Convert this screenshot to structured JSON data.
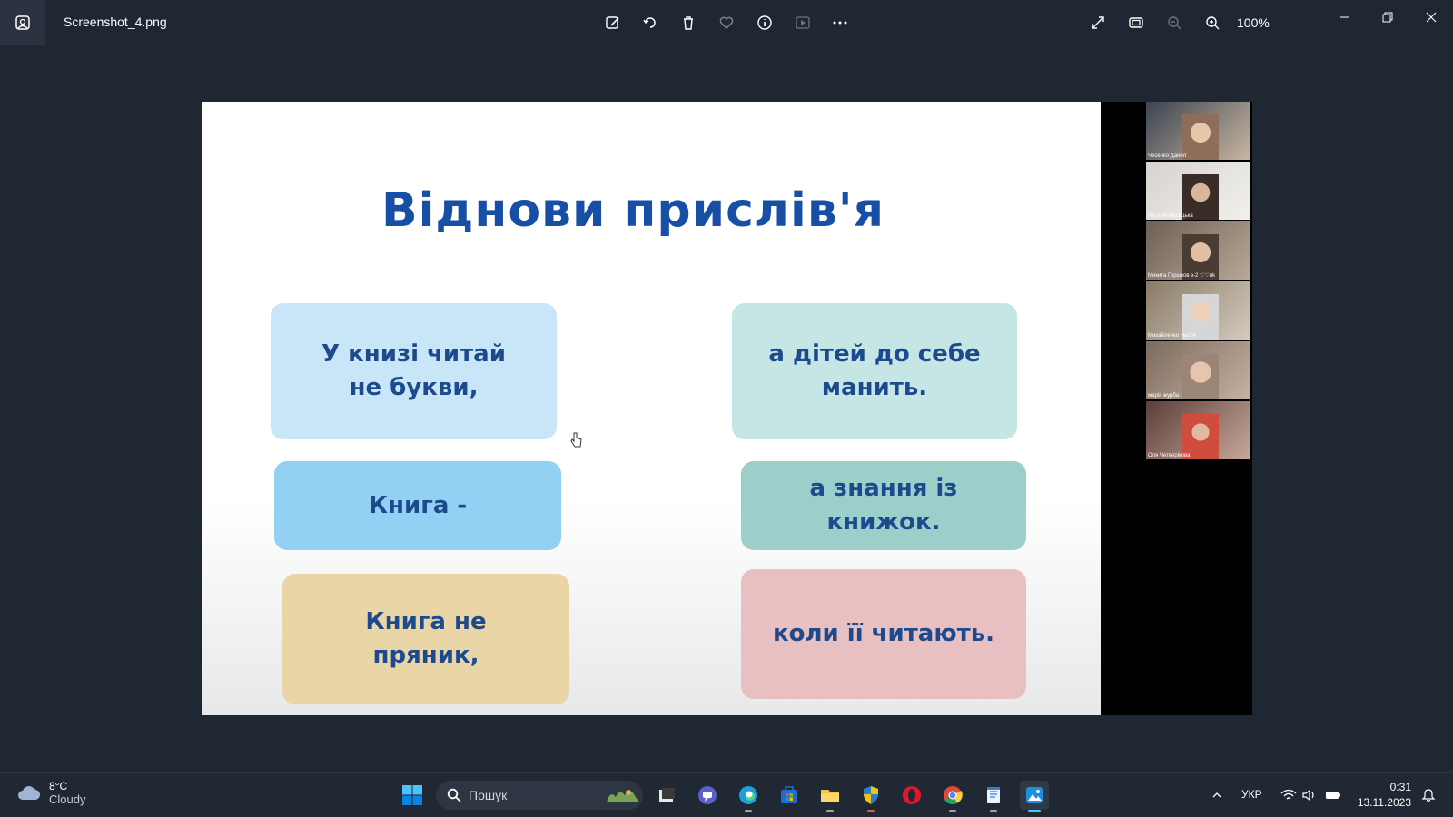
{
  "window": {
    "filename": "Screenshot_4.png",
    "zoom": "100%"
  },
  "slide": {
    "title": "Віднови прислів'я",
    "cards": [
      "У книзі читай\nне букви,",
      "а дітей до себе\nманить.",
      "Книга -",
      "а знання із\nкнижок.",
      "Книга не\nпряник,",
      "коли її читають."
    ]
  },
  "participants": [
    "Чесенко Данил",
    "Наталія Весоцька",
    "Микита Горшков з-2 ♡♡uk",
    "Михайленко Настя",
    "марія журба",
    "Оля Четверікова"
  ],
  "taskbar": {
    "temperature": "8°C",
    "condition": "Cloudy",
    "search_placeholder": "Пошук",
    "language": "УКР",
    "time": "0:31",
    "date": "13.11.2023"
  },
  "colors": {
    "title_blue": "#174ea6",
    "card_text": "#1c4a8c"
  }
}
